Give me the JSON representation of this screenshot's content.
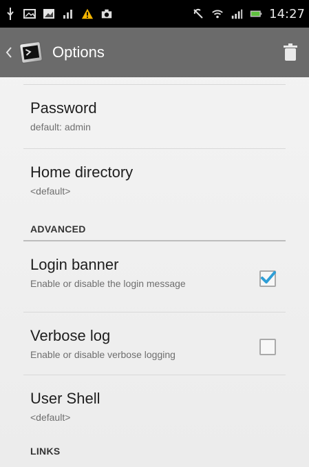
{
  "status_bar": {
    "time": "14:27"
  },
  "action_bar": {
    "title": "Options"
  },
  "items": [
    {
      "title": "Password",
      "summary": "default: admin"
    },
    {
      "title": "Home directory",
      "summary": "<default>"
    }
  ],
  "categories": {
    "advanced": "ADVANCED",
    "links": "LINKS"
  },
  "advanced_items": [
    {
      "title": "Login banner",
      "summary": "Enable or disable the login message",
      "checked": true
    },
    {
      "title": "Verbose log",
      "summary": "Enable or disable verbose logging",
      "checked": false
    },
    {
      "title": "User Shell",
      "summary": "<default>"
    }
  ],
  "colors": {
    "action_bar": "#6b6b6b",
    "accent_check": "#2f9ed6"
  },
  "icons": [
    "usb-icon",
    "image-icon",
    "photo-icon",
    "signal-bars-icon",
    "warning-icon",
    "camera-icon",
    "no-rotate-icon",
    "wifi-icon",
    "cell-signal-icon",
    "battery-icon",
    "back-caret-icon",
    "terminal-app-icon",
    "trash-icon",
    "checkmark-icon"
  ]
}
